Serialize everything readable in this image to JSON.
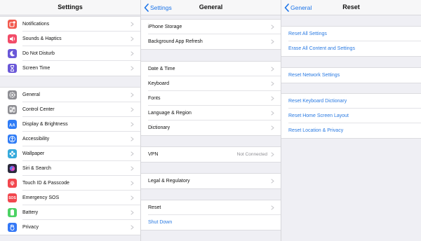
{
  "settings": {
    "title": "Settings",
    "groups": [
      [
        {
          "label": "Notifications",
          "icon": "notifications-icon",
          "color": "#f25a4e"
        },
        {
          "label": "Sounds & Haptics",
          "icon": "speaker-icon",
          "color": "#f24c68"
        },
        {
          "label": "Do Not Disturb",
          "icon": "moon-icon",
          "color": "#6a58d8"
        },
        {
          "label": "Screen Time",
          "icon": "hourglass-icon",
          "color": "#6a58d8"
        }
      ],
      [
        {
          "label": "General",
          "icon": "gear-icon",
          "color": "#8e8e93"
        },
        {
          "label": "Control Center",
          "icon": "toggles-icon",
          "color": "#8e8e93"
        },
        {
          "label": "Display & Brightness",
          "icon": "text-size-icon",
          "color": "#2f7cf6"
        },
        {
          "label": "Accessibility",
          "icon": "accessibility-icon",
          "color": "#2f7cf6"
        },
        {
          "label": "Wallpaper",
          "icon": "flower-icon",
          "color": "#36aadc"
        },
        {
          "label": "Siri & Search",
          "icon": "siri-icon",
          "color": "#2b2b3c"
        },
        {
          "label": "Touch ID & Passcode",
          "icon": "fingerprint-icon",
          "color": "#f2474e"
        },
        {
          "label": "Emergency SOS",
          "icon": "sos-icon",
          "color": "#f2474e",
          "text": "SOS"
        },
        {
          "label": "Battery",
          "icon": "battery-icon",
          "color": "#4cd264"
        },
        {
          "label": "Privacy",
          "icon": "hand-icon",
          "color": "#3478f6"
        }
      ]
    ]
  },
  "general": {
    "back_label": "Settings",
    "title": "General",
    "groups": [
      [
        {
          "label": "iPhone Storage"
        },
        {
          "label": "Background App Refresh"
        }
      ],
      [
        {
          "label": "Date & Time"
        },
        {
          "label": "Keyboard"
        },
        {
          "label": "Fonts"
        },
        {
          "label": "Language & Region"
        },
        {
          "label": "Dictionary"
        }
      ],
      [
        {
          "label": "VPN",
          "detail": "Not Connected"
        }
      ],
      [
        {
          "label": "Legal & Regulatory"
        }
      ],
      [
        {
          "label": "Reset"
        },
        {
          "label": "Shut Down",
          "blue": true
        }
      ]
    ]
  },
  "reset": {
    "back_label": "General",
    "title": "Reset",
    "groups": [
      [
        {
          "label": "Reset All Settings"
        },
        {
          "label": "Erase All Content and Settings"
        }
      ],
      [
        {
          "label": "Reset Network Settings"
        }
      ],
      [
        {
          "label": "Reset Keyboard Dictionary"
        },
        {
          "label": "Reset Home Screen Layout"
        },
        {
          "label": "Reset Location & Privacy"
        }
      ]
    ]
  }
}
